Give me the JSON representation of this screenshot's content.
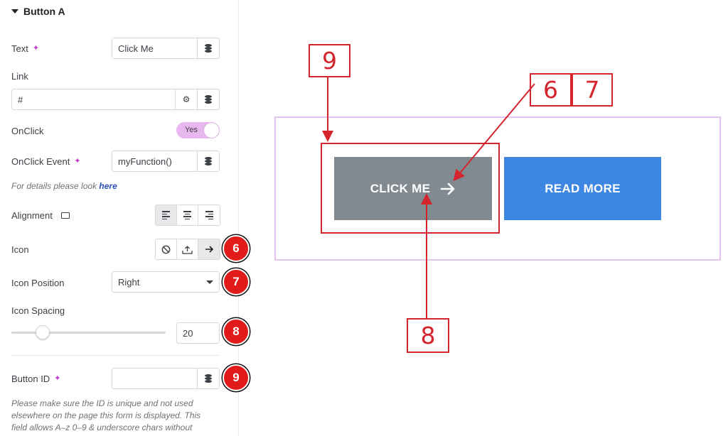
{
  "panel": {
    "section_title": "Button A",
    "text_label": "Text",
    "text_value": "Click Me",
    "link_label": "Link",
    "link_value": "#",
    "onclick_label": "OnClick",
    "onclick_toggle": "Yes",
    "onclick_event_label": "OnClick Event",
    "onclick_event_value": "myFunction()",
    "details_note": "For details please look",
    "details_link": "here",
    "alignment_label": "Alignment",
    "icon_label": "Icon",
    "icon_position_label": "Icon Position",
    "icon_position_value": "Right",
    "icon_spacing_label": "Icon Spacing",
    "icon_spacing_value": "20",
    "button_id_label": "Button ID",
    "button_id_value": "",
    "id_note_line1": "Please make sure the ID is unique and not used",
    "id_note_line2": "elsewhere on the page this form is displayed. This",
    "id_note_line3": "field allows A–z  0–9 & underscore chars without"
  },
  "badges": {
    "icon": "6",
    "icon_position": "7",
    "icon_spacing": "8",
    "button_id": "9"
  },
  "preview": {
    "button_a": "CLICK ME",
    "button_b": "READ MORE"
  },
  "callouts": {
    "c9": "9",
    "c6": "6",
    "c7": "7",
    "c8": "8"
  },
  "icons": {
    "ai": "sparkle-icon",
    "database": "database-icon",
    "settings": "gear-icon",
    "desktop": "desktop-icon",
    "none": "ban-icon",
    "upload": "upload-icon",
    "arrow": "arrow-right-icon"
  },
  "colors": {
    "accent_pink": "#e8b7ef",
    "badge_red": "#e11a1a",
    "annotation_red": "#d4252d",
    "button_gray": "#818a91",
    "button_blue": "#3d87e3",
    "preview_border": "#e4c3ee"
  },
  "slider": {
    "value": 20
  }
}
